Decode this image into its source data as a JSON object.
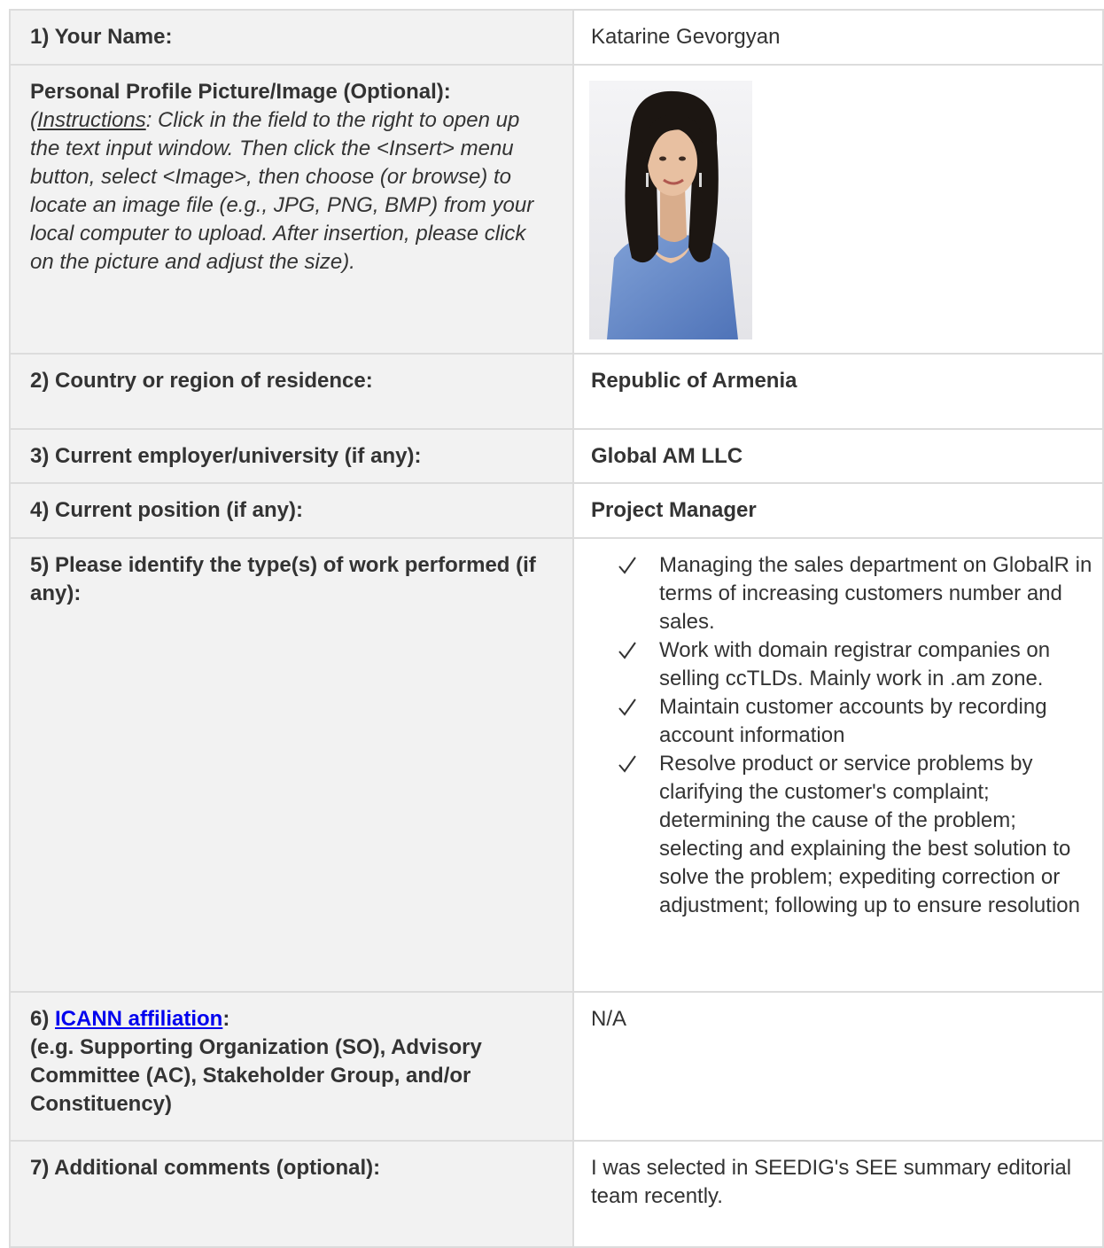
{
  "rows": {
    "name": {
      "label": "1) Your Name:",
      "value": "Katarine Gevorgyan"
    },
    "photo": {
      "label": "Personal Profile Picture/Image (Optional):",
      "instructions_prefix": "(",
      "instructions_link": "Instructions",
      "instructions_text": ": Click in the field to the right to open up the text input window. Then click the <Insert> menu button, select <Image>, then choose (or browse) to locate an image file (e.g., JPG, PNG, BMP) from your local computer to upload. After insertion, please click on the picture and adjust the size)."
    },
    "country": {
      "label": "2) Country or region of residence:",
      "value": "Republic of Armenia"
    },
    "employer": {
      "label": "3) Current employer/university (if any):",
      "value": "Global AM LLC"
    },
    "position": {
      "label": "4) Current position (if any):",
      "value": "Project Manager"
    },
    "work": {
      "label": "5) Please identify the type(s) of work performed (if any):",
      "items": [
        "Managing the sales department on GlobalR in terms of increasing customers number and sales.",
        "Work with domain registrar companies on selling ccTLDs. Mainly work in .am zone.",
        "Maintain customer accounts by recording account information",
        "Resolve product or service problems by clarifying the customer's complaint; determining the cause of the problem; selecting and explaining the best solution to solve the problem; expediting correction or adjustment; following up to ensure resolution"
      ]
    },
    "affiliation": {
      "label_prefix": "6) ",
      "label_link": "ICANN affiliation",
      "label_suffix": ":",
      "label_detail": "(e.g. Supporting Organization (SO), Advisory Committee (AC), Stakeholder Group, and/or Constituency)",
      "value": "N/A"
    },
    "comments": {
      "label": "7) Additional comments (optional):",
      "value": "I was selected in SEEDIG's SEE summary editorial team recently."
    }
  },
  "icons": {
    "check": "checkmark-icon"
  },
  "colors": {
    "label_bg": "#f2f2f2",
    "border": "#dcdcdc",
    "link": "#0000ee",
    "text": "#333333"
  }
}
